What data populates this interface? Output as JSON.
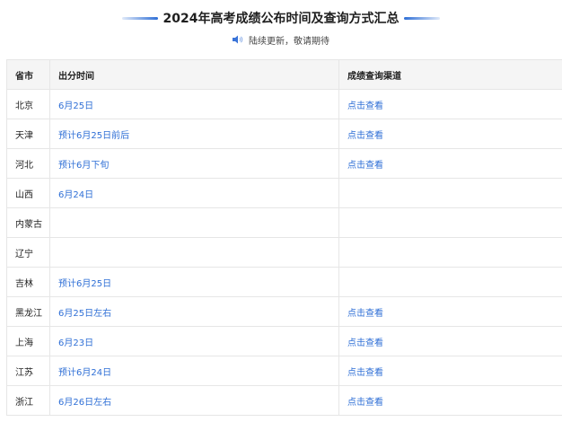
{
  "header": {
    "title": "2024年高考成绩公布时间及查询方式汇总",
    "subtitle": "陆续更新，敬请期待",
    "subtitle_icon": "speaker-icon",
    "accent_color": "#2f6fd6"
  },
  "table": {
    "columns": [
      "省市",
      "出分时间",
      "成绩查询渠道"
    ],
    "rows": [
      {
        "province": "北京",
        "time": "6月25日",
        "link": "点击查看"
      },
      {
        "province": "天津",
        "time": "预计6月25日前后",
        "link": "点击查看"
      },
      {
        "province": "河北",
        "time": "预计6月下旬",
        "link": "点击查看"
      },
      {
        "province": "山西",
        "time": "6月24日",
        "link": ""
      },
      {
        "province": "内蒙古",
        "time": "",
        "link": ""
      },
      {
        "province": "辽宁",
        "time": "",
        "link": ""
      },
      {
        "province": "吉林",
        "time": "预计6月25日",
        "link": ""
      },
      {
        "province": "黑龙江",
        "time": "6月25日左右",
        "link": "点击查看"
      },
      {
        "province": "上海",
        "time": "6月23日",
        "link": "点击查看"
      },
      {
        "province": "江苏",
        "time": "预计6月24日",
        "link": "点击查看"
      },
      {
        "province": "浙江",
        "time": "6月26日左右",
        "link": "点击查看"
      }
    ]
  }
}
